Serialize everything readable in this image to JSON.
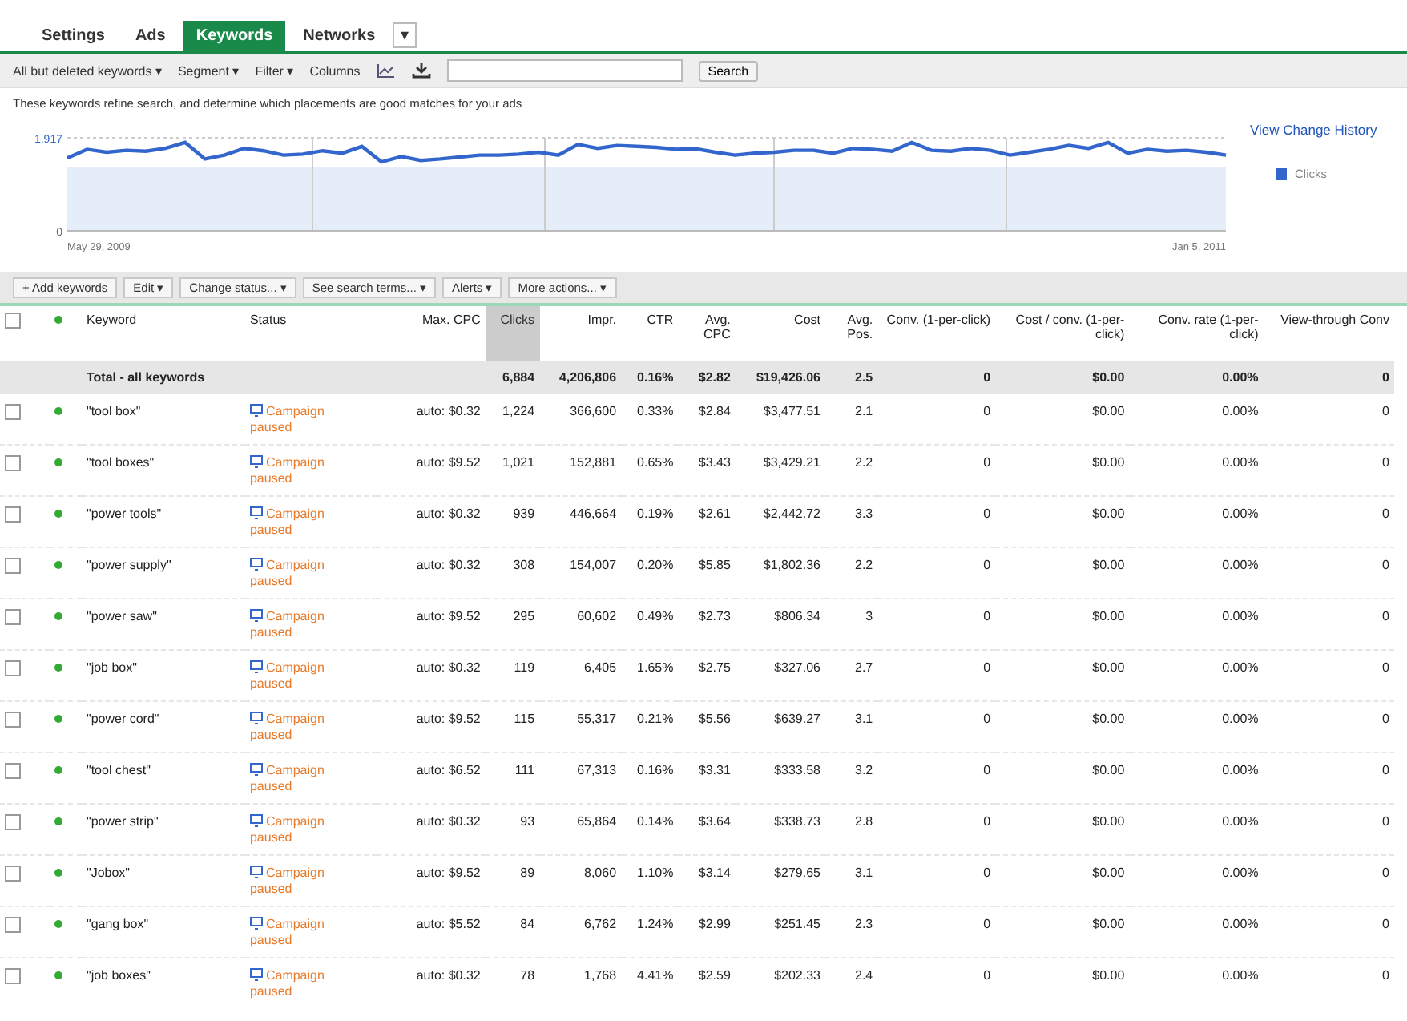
{
  "tabs": [
    {
      "label": "Settings",
      "selected": false
    },
    {
      "label": "Ads",
      "selected": false
    },
    {
      "label": "Keywords",
      "selected": true
    },
    {
      "label": "Networks",
      "selected": false
    },
    {
      "label": "▾",
      "selected": false
    }
  ],
  "toolbar": {
    "menus": [
      "All but deleted keywords ▾",
      "Segment ▾",
      "Filter ▾",
      "Columns"
    ],
    "search_button": "Search"
  },
  "description": "These keywords refine search, and determine which placements are good matches for your ads",
  "chart": {
    "link": "View Change History",
    "start_date": "May 29, 2009",
    "end_date": "Jan 5, 2011",
    "chart_data": {
      "type": "line",
      "ylim": [
        0,
        1917
      ],
      "yticks": [
        0,
        {
          "value": 1917,
          "label": "1,917"
        }
      ],
      "series": [
        {
          "name": "Clicks",
          "color": "#3366cc",
          "values": [
            1500,
            1680,
            1620,
            1660,
            1640,
            1700,
            1820,
            1480,
            1560,
            1700,
            1650,
            1560,
            1580,
            1650,
            1600,
            1740,
            1420,
            1530,
            1450,
            1480,
            1520,
            1560,
            1560,
            1580,
            1620,
            1560,
            1780,
            1700,
            1760,
            1740,
            1720,
            1680,
            1690,
            1620,
            1560,
            1600,
            1620,
            1660,
            1660,
            1600,
            1700,
            1680,
            1640,
            1820,
            1660,
            1640,
            1700,
            1660,
            1560,
            1620,
            1680,
            1760,
            1700,
            1820,
            1600,
            1680,
            1640,
            1660,
            1620,
            1560
          ]
        }
      ]
    }
  },
  "actions": [
    "+ Add keywords",
    "Edit ▾",
    "Change status... ▾",
    "See search terms... ▾",
    "Alerts ▾",
    "More actions... ▾"
  ],
  "table": {
    "columns": [
      {
        "label": "Keyword",
        "sorted": false
      },
      {
        "label": "Status",
        "sorted": false
      },
      {
        "label": "Max. CPC",
        "sorted": false
      },
      {
        "label": "Clicks",
        "sorted": true
      },
      {
        "label": "Impr.",
        "sorted": false
      },
      {
        "label": "CTR",
        "sorted": false
      },
      {
        "label": "Avg. CPC",
        "sorted": false
      },
      {
        "label": "Cost",
        "sorted": false
      },
      {
        "label": "Avg. Pos.",
        "sorted": false
      },
      {
        "label": "Conv. (1-per-click)",
        "sorted": false
      },
      {
        "label": "Cost / conv. (1-per-click)",
        "sorted": false
      },
      {
        "label": "Conv. rate (1-per-click)",
        "sorted": false
      },
      {
        "label": "View-through Conv",
        "sorted": false
      }
    ],
    "select_all_checked": false,
    "total": {
      "label": "Total - all keywords",
      "cells": [
        "6,884",
        "4,206,806",
        "0.16%",
        "$2.82",
        "$19,426.06",
        "2.5",
        "0",
        "$0.00",
        "0.00%",
        "0"
      ]
    },
    "rows": [
      {
        "checked": false,
        "cells": [
          "\"tool box\"",
          "Campaign paused",
          "auto: $0.32",
          "1,224",
          "366,600",
          "0.33%",
          "$2.84",
          "$3,477.51",
          "2.1",
          "0",
          "$0.00",
          "0.00%",
          "0"
        ]
      },
      {
        "checked": false,
        "cells": [
          "\"tool boxes\"",
          "Campaign paused",
          "auto: $9.52",
          "1,021",
          "152,881",
          "0.65%",
          "$3.43",
          "$3,429.21",
          "2.2",
          "0",
          "$0.00",
          "0.00%",
          "0"
        ]
      },
      {
        "checked": false,
        "cells": [
          "\"power tools\"",
          "Campaign paused",
          "auto: $0.32",
          "939",
          "446,664",
          "0.19%",
          "$2.61",
          "$2,442.72",
          "3.3",
          "0",
          "$0.00",
          "0.00%",
          "0"
        ]
      },
      {
        "checked": false,
        "cells": [
          "\"power supply\"",
          "Campaign paused",
          "auto: $0.32",
          "308",
          "154,007",
          "0.20%",
          "$5.85",
          "$1,802.36",
          "2.2",
          "0",
          "$0.00",
          "0.00%",
          "0"
        ]
      },
      {
        "checked": false,
        "cells": [
          "\"power saw\"",
          "Campaign paused",
          "auto: $9.52",
          "295",
          "60,602",
          "0.49%",
          "$2.73",
          "$806.34",
          "3",
          "0",
          "$0.00",
          "0.00%",
          "0"
        ]
      },
      {
        "checked": false,
        "cells": [
          "\"job box\"",
          "Campaign paused",
          "auto: $0.32",
          "119",
          "6,405",
          "1.65%",
          "$2.75",
          "$327.06",
          "2.7",
          "0",
          "$0.00",
          "0.00%",
          "0"
        ]
      },
      {
        "checked": false,
        "cells": [
          "\"power cord\"",
          "Campaign paused",
          "auto: $9.52",
          "115",
          "55,317",
          "0.21%",
          "$5.56",
          "$639.27",
          "3.1",
          "0",
          "$0.00",
          "0.00%",
          "0"
        ]
      },
      {
        "checked": false,
        "cells": [
          "\"tool chest\"",
          "Campaign paused",
          "auto: $6.52",
          "111",
          "67,313",
          "0.16%",
          "$3.31",
          "$333.58",
          "3.2",
          "0",
          "$0.00",
          "0.00%",
          "0"
        ]
      },
      {
        "checked": false,
        "cells": [
          "\"power strip\"",
          "Campaign paused",
          "auto: $0.32",
          "93",
          "65,864",
          "0.14%",
          "$3.64",
          "$338.73",
          "2.8",
          "0",
          "$0.00",
          "0.00%",
          "0"
        ]
      },
      {
        "checked": false,
        "cells": [
          "\"Jobox\"",
          "Campaign paused",
          "auto: $9.52",
          "89",
          "8,060",
          "1.10%",
          "$3.14",
          "$279.65",
          "3.1",
          "0",
          "$0.00",
          "0.00%",
          "0"
        ]
      },
      {
        "checked": false,
        "cells": [
          "\"gang box\"",
          "Campaign paused",
          "auto: $5.52",
          "84",
          "6,762",
          "1.24%",
          "$2.99",
          "$251.45",
          "2.3",
          "0",
          "$0.00",
          "0.00%",
          "0"
        ]
      },
      {
        "checked": false,
        "cells": [
          "\"job boxes\"",
          "Campaign paused",
          "auto: $0.32",
          "78",
          "1,768",
          "4.41%",
          "$2.59",
          "$202.33",
          "2.4",
          "0",
          "$0.00",
          "0.00%",
          "0"
        ]
      }
    ]
  }
}
